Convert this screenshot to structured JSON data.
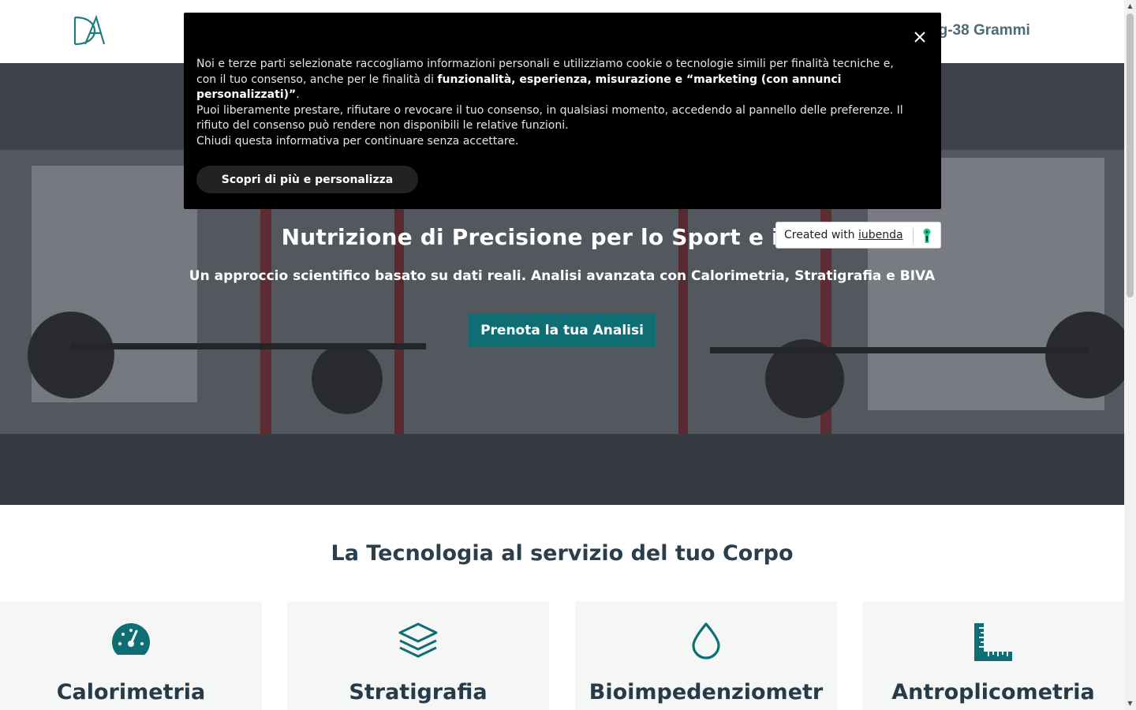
{
  "header": {
    "nav_partial_label": "og-38 Grammi"
  },
  "hero": {
    "title": "Nutrizione di Precisione per lo Sport e il Ben",
    "subtitle": "Un approccio scientifico basato su dati reali. Analisi avanzata con Calorimetria, Stratigrafia e BIVA",
    "cta_label": "Prenota la tua Analisi"
  },
  "section": {
    "title": "La Tecnologia al servizio del tuo Corpo",
    "cards": [
      {
        "title": "Calorimetria",
        "icon": "gauge-icon"
      },
      {
        "title": "Stratigrafia",
        "icon": "layers-icon"
      },
      {
        "title": "Bioimpedenziometr",
        "icon": "drop-icon"
      },
      {
        "title": "Antroplicometria",
        "icon": "ruler-icon"
      }
    ]
  },
  "cookie": {
    "line1": "Noi e terze parti selezionate raccogliamo informazioni personali e utilizziamo cookie o tecnologie simili per finalità tecniche e, con il tuo consenso, anche per le finalità di ",
    "bold": "funzionalità, esperienza, misurazione e “marketing (con annunci personalizzati)”",
    "line1_end": ".",
    "line2": "Puoi liberamente prestare, rifiutare o revocare il tuo consenso, in qualsiasi momento, accedendo al pannello delle preferenze. Il rifiuto del consenso può rendere non disponibili le relative funzioni.",
    "line3": "Chiudi questa informativa per continuare senza accettare.",
    "button_label": "Scopri di più e personalizza"
  },
  "badge": {
    "prefix": "Created with ",
    "link": "iubenda"
  },
  "colors": {
    "accent": "#0e6e73",
    "heading": "#2b3e4b",
    "card_bg": "#f4f7f5"
  }
}
